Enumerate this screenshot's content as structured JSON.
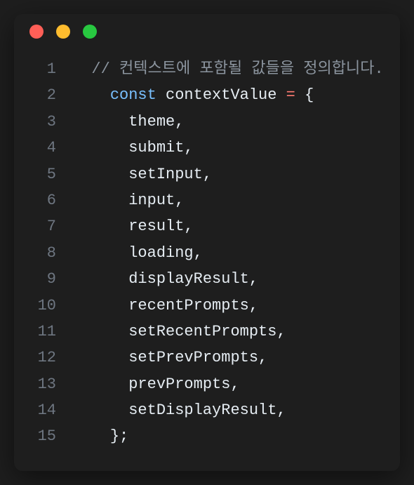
{
  "code": {
    "lines": [
      {
        "num": "1",
        "indent": "  ",
        "tokens": [
          {
            "cls": "comment",
            "text": "// 컨텍스트에 포함될 값들을 정의합니다."
          }
        ]
      },
      {
        "num": "2",
        "indent": "    ",
        "tokens": [
          {
            "cls": "keyword",
            "text": "const"
          },
          {
            "cls": "identifier",
            "text": " contextValue "
          },
          {
            "cls": "operator",
            "text": "="
          },
          {
            "cls": "punct",
            "text": " {"
          }
        ]
      },
      {
        "num": "3",
        "indent": "      ",
        "tokens": [
          {
            "cls": "identifier",
            "text": "theme,"
          }
        ]
      },
      {
        "num": "4",
        "indent": "      ",
        "tokens": [
          {
            "cls": "identifier",
            "text": "submit,"
          }
        ]
      },
      {
        "num": "5",
        "indent": "      ",
        "tokens": [
          {
            "cls": "identifier",
            "text": "setInput,"
          }
        ]
      },
      {
        "num": "6",
        "indent": "      ",
        "tokens": [
          {
            "cls": "identifier",
            "text": "input,"
          }
        ]
      },
      {
        "num": "7",
        "indent": "      ",
        "tokens": [
          {
            "cls": "identifier",
            "text": "result,"
          }
        ]
      },
      {
        "num": "8",
        "indent": "      ",
        "tokens": [
          {
            "cls": "identifier",
            "text": "loading,"
          }
        ]
      },
      {
        "num": "9",
        "indent": "      ",
        "tokens": [
          {
            "cls": "identifier",
            "text": "displayResult,"
          }
        ]
      },
      {
        "num": "10",
        "indent": "      ",
        "tokens": [
          {
            "cls": "identifier",
            "text": "recentPrompts,"
          }
        ]
      },
      {
        "num": "11",
        "indent": "      ",
        "tokens": [
          {
            "cls": "identifier",
            "text": "setRecentPrompts,"
          }
        ]
      },
      {
        "num": "12",
        "indent": "      ",
        "tokens": [
          {
            "cls": "identifier",
            "text": "setPrevPrompts,"
          }
        ]
      },
      {
        "num": "13",
        "indent": "      ",
        "tokens": [
          {
            "cls": "identifier",
            "text": "prevPrompts,"
          }
        ]
      },
      {
        "num": "14",
        "indent": "      ",
        "tokens": [
          {
            "cls": "identifier",
            "text": "setDisplayResult,"
          }
        ]
      },
      {
        "num": "15",
        "indent": "    ",
        "tokens": [
          {
            "cls": "punct",
            "text": "};"
          }
        ]
      }
    ]
  }
}
